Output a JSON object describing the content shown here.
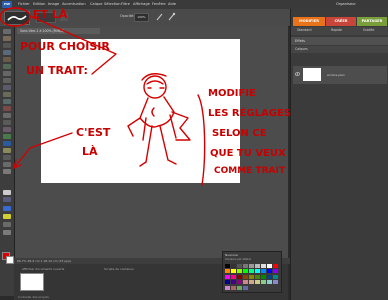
{
  "menubar": {
    "logo": "PSE",
    "items": [
      "Fichier",
      "Edition",
      "Image",
      "Accentuation",
      "Calque",
      "Sélection",
      "Filtre",
      "Affichage",
      "Fenêtre",
      "Aide"
    ],
    "organizer": "Organiseur"
  },
  "options": {
    "opacity_label": "Opacité:",
    "opacity_value": "100%"
  },
  "document": {
    "tab_title": "Sans titre-1 à 100% (RVB/8)",
    "status": "66.7% 26.4 cm x 18.14 cm (72 ppp)"
  },
  "right_panel": {
    "tabs": [
      "MODIFIER",
      "CRÉER",
      "PARTAGER"
    ],
    "buttons": [
      "Standard",
      "Rapide",
      "Guidée"
    ],
    "effects_label": "Effets",
    "layers_label": "Calques",
    "layer_name": "Arrière-plan"
  },
  "bin": {
    "label": "Affichier documents ouverts",
    "label2": "Corbeille des projets",
    "label3": "Scripts de contenus"
  },
  "swatches": {
    "title": "Nuancier",
    "set": "Couleurs par défaut"
  },
  "annotations": {
    "top": "ET LÀ",
    "left1": "POUR CHOISIR",
    "left2": "UN TRAIT:",
    "mid1": "C'EST",
    "mid2": "LÀ",
    "right": [
      "MODIFIE",
      "LES RÉGLAGES",
      "SELON CE",
      "QUE TU VEUX",
      "COMME TRAIT"
    ]
  },
  "colors": {
    "accent_modifier": "#e8731a",
    "accent_creer": "#c8453a",
    "accent_partager": "#7a9e3a",
    "annotation": "#d40000"
  }
}
